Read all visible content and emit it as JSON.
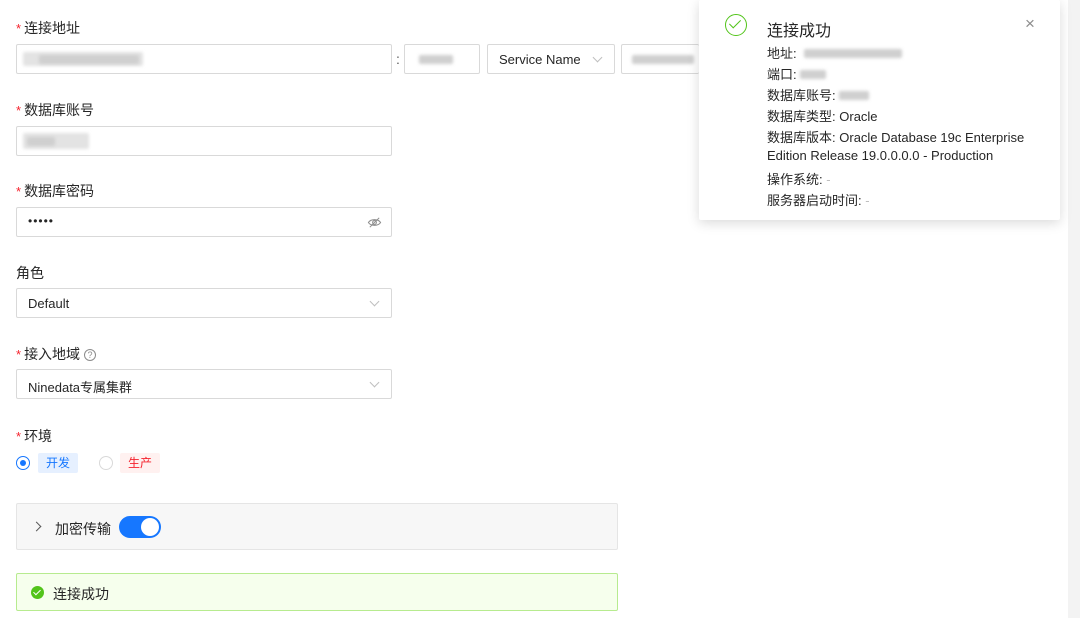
{
  "form": {
    "address_label": "连接地址",
    "port_separator": ":",
    "service_type": "Service Name",
    "account_label": "数据库账号",
    "password_label": "数据库密码",
    "password_value": "•••••",
    "role_label": "角色",
    "role_value": "Default",
    "region_label": "接入地域",
    "region_help": "?",
    "region_value": "Ninedata专属集群",
    "env_label": "环境",
    "env_options": [
      "开发",
      "生产"
    ],
    "env_selected": "开发",
    "encrypt_label": "加密传输",
    "encrypt_enabled": true,
    "required_mark": "*"
  },
  "status": {
    "text": "连接成功"
  },
  "notification": {
    "title": "连接成功",
    "close": "×",
    "lines": [
      {
        "label": "地址:",
        "value": ""
      },
      {
        "label": "端口:",
        "value": ""
      },
      {
        "label": "数据库账号:",
        "value": ""
      },
      {
        "label": "数据库类型:",
        "value": "Oracle"
      },
      {
        "label": "数据库版本:",
        "value": "Oracle Database 19c Enterprise"
      },
      {
        "label": "",
        "value": "Edition Release 19.0.0.0.0 - Production"
      },
      {
        "label": "操作系统:",
        "value": "-"
      },
      {
        "label": "服务器启动时间:",
        "value": "-"
      }
    ]
  },
  "icons": {
    "eye_off": "eye-off-icon",
    "chevron": "chevron-down-icon",
    "success": "check-circle-icon",
    "expand": "chevron-right-icon"
  },
  "colors": {
    "primary": "#1677ff",
    "success": "#52c41a",
    "danger": "#f5222d"
  }
}
